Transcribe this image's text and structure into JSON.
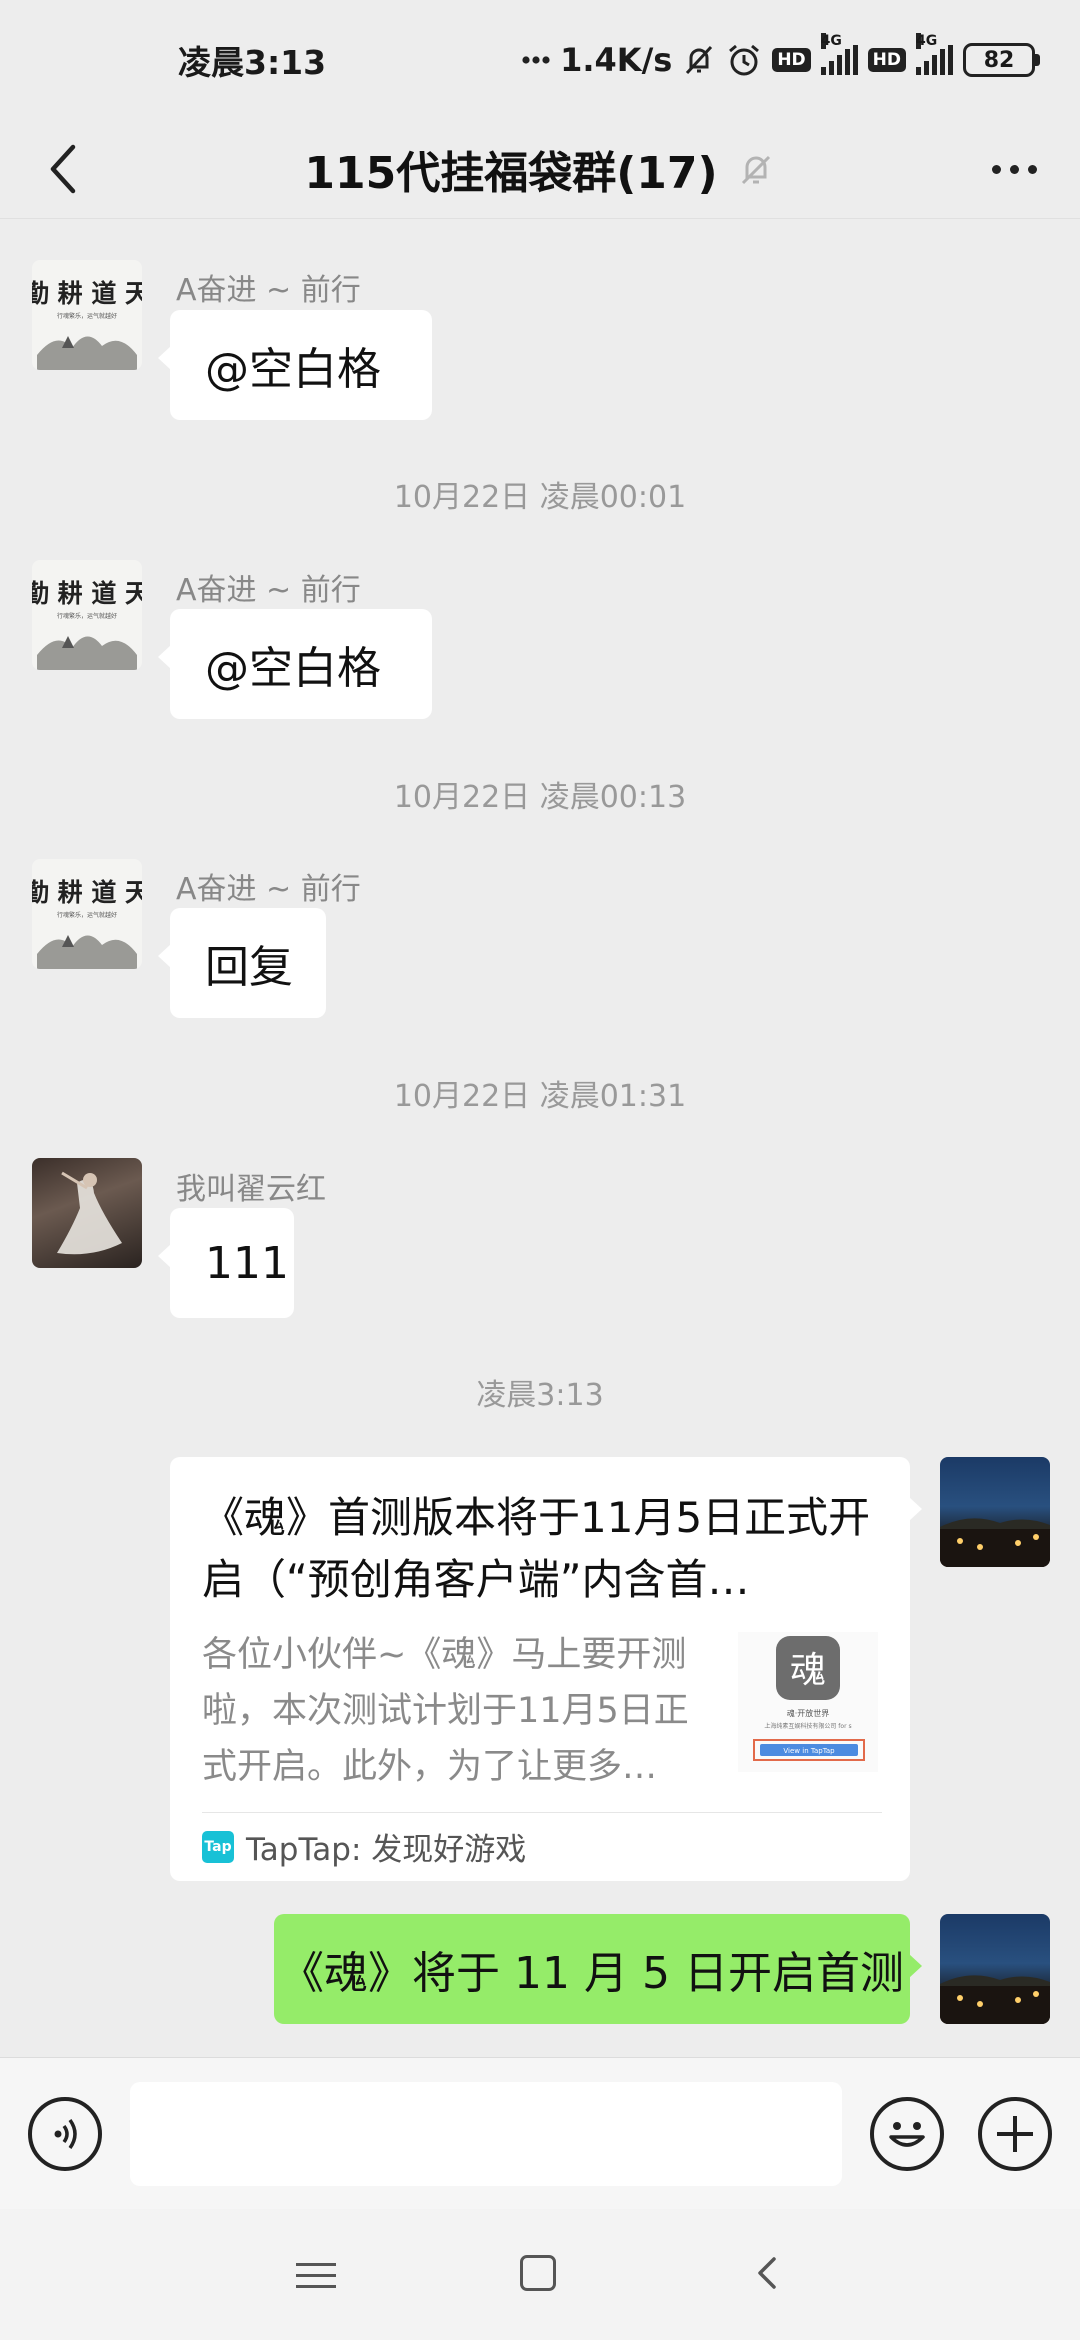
{
  "status_bar": {
    "time": "凌晨3:13",
    "speed": "1.4K/s",
    "hd1": "HD",
    "hd2": "HD",
    "net1": "4G",
    "net2": "4G",
    "battery": "82"
  },
  "header": {
    "title": "115代挂福袋群(17)",
    "icons": [
      "back-arrow-icon",
      "mute-bell-icon",
      "more-dots-icon"
    ]
  },
  "messages": [
    {
      "sender": "A奋进 ~ 前行",
      "text": "@空白格"
    },
    {
      "timestamp": "10月22日 凌晨00:01"
    },
    {
      "sender": "A奋进 ~ 前行",
      "text": "@空白格"
    },
    {
      "timestamp": "10月22日 凌晨00:13"
    },
    {
      "sender": "A奋进 ~ 前行",
      "text": "回复"
    },
    {
      "timestamp": "10月22日 凌晨01:31"
    },
    {
      "sender": "我叫翟云红",
      "text": "111"
    },
    {
      "timestamp": "凌晨3:13"
    }
  ],
  "avatar_text": {
    "callig": "勤 耕 道 天",
    "callig_sub": "行魂繁乐，运气就越好"
  },
  "link_card": {
    "title": "《魂》首测版本将于11月5日正式开启（“预创角客户端”内含首…",
    "description": "各位小伙伴~《魂》马上要开测啦，本次测试计划于11月5日正式开启。此外，为了让更多…",
    "source": "TapTap: 发现好游戏",
    "source_logo": "Tap",
    "thumb_char": "魂",
    "thumb_line1": "魂·开放世界",
    "thumb_line2": "上海纯素互娱科技有限公司 for s",
    "thumb_button": "View in TapTap"
  },
  "outgoing_text": {
    "text": "《魂》将于 11 月 5 日开启首测"
  },
  "input_bar": {
    "placeholder": "",
    "icons": [
      "voice-icon",
      "emoji-icon",
      "plus-icon"
    ]
  },
  "nav_bar": {
    "icons": [
      "menu-icon",
      "home-icon",
      "back-icon"
    ]
  },
  "colors": {
    "background": "#ededed",
    "bubble_in": "#ffffff",
    "bubble_out": "#95ec69",
    "timestamp": "#999999"
  }
}
